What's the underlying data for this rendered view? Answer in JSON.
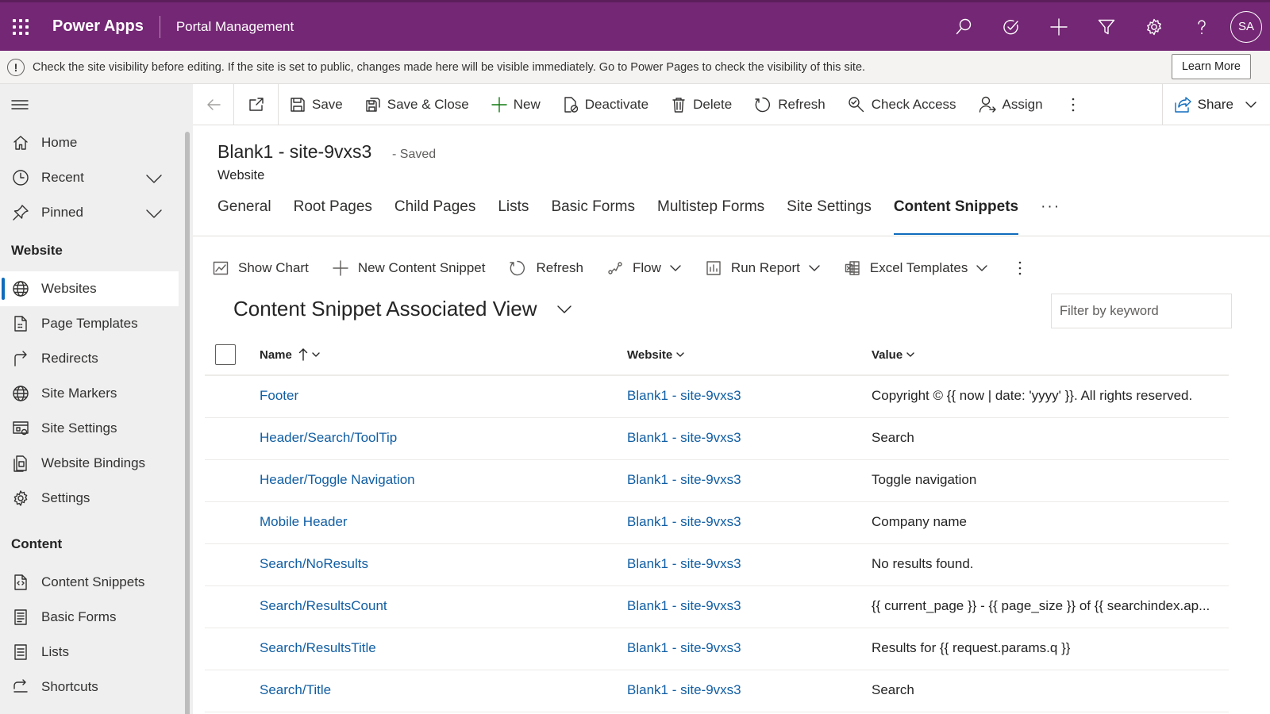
{
  "header": {
    "app_name": "Power Apps",
    "env_name": "Portal Management",
    "user_initials": "SA",
    "icons": [
      "search-icon",
      "task-icon",
      "plus-icon",
      "filter-icon",
      "settings-icon",
      "help-icon"
    ]
  },
  "notice": {
    "text": "Check the site visibility before editing. If the site is set to public, changes made here will be visible immediately. Go to Power Pages to check the visibility of this site.",
    "button": "Learn More"
  },
  "sidebar": {
    "top_items": [
      {
        "label": "Home",
        "icon": "home-icon"
      },
      {
        "label": "Recent",
        "icon": "clock-icon"
      },
      {
        "label": "Pinned",
        "icon": "pin-icon"
      }
    ],
    "groups": [
      {
        "title": "Website",
        "items": [
          {
            "label": "Websites",
            "icon": "globe-icon",
            "active": true
          },
          {
            "label": "Page Templates",
            "icon": "page-icon"
          },
          {
            "label": "Redirects",
            "icon": "redirect-icon"
          },
          {
            "label": "Site Markers",
            "icon": "globe-icon"
          },
          {
            "label": "Site Settings",
            "icon": "settings-grid-icon"
          },
          {
            "label": "Website Bindings",
            "icon": "binding-icon"
          },
          {
            "label": "Settings",
            "icon": "gear-icon"
          }
        ]
      },
      {
        "title": "Content",
        "items": [
          {
            "label": "Content Snippets",
            "icon": "snippet-icon"
          },
          {
            "label": "Basic Forms",
            "icon": "form-icon"
          },
          {
            "label": "Lists",
            "icon": "list-icon"
          },
          {
            "label": "Shortcuts",
            "icon": "shortcut-icon"
          }
        ]
      }
    ]
  },
  "commands": {
    "save": "Save",
    "save_close": "Save & Close",
    "new": "New",
    "deactivate": "Deactivate",
    "delete": "Delete",
    "refresh": "Refresh",
    "check_access": "Check Access",
    "assign": "Assign",
    "share": "Share"
  },
  "form": {
    "title": "Blank1 - site-9vxs3",
    "status": "- Saved",
    "entity": "Website",
    "tabs": [
      "General",
      "Root Pages",
      "Child Pages",
      "Lists",
      "Basic Forms",
      "Multistep Forms",
      "Site Settings",
      "Content Snippets"
    ],
    "active_tab": "Content Snippets",
    "more": "···"
  },
  "subgrid": {
    "commands": {
      "show_chart": "Show Chart",
      "new_snippet": "New Content Snippet",
      "refresh": "Refresh",
      "flow": "Flow",
      "run_report": "Run Report",
      "excel": "Excel Templates"
    },
    "view_title": "Content Snippet Associated View",
    "filter_placeholder": "Filter by keyword",
    "columns": {
      "name": "Name",
      "website": "Website",
      "value": "Value"
    },
    "rows": [
      {
        "name": "Footer",
        "website": "Blank1 - site-9vxs3",
        "value": "Copyright © {{ now | date: 'yyyy' }}. All rights reserved."
      },
      {
        "name": "Header/Search/ToolTip",
        "website": "Blank1 - site-9vxs3",
        "value": "Search"
      },
      {
        "name": "Header/Toggle Navigation",
        "website": "Blank1 - site-9vxs3",
        "value": "Toggle navigation"
      },
      {
        "name": "Mobile Header",
        "website": "Blank1 - site-9vxs3",
        "value": "Company name"
      },
      {
        "name": "Search/NoResults",
        "website": "Blank1 - site-9vxs3",
        "value": "No results found."
      },
      {
        "name": "Search/ResultsCount",
        "website": "Blank1 - site-9vxs3",
        "value": "{{ current_page }} - {{ page_size }} of {{ searchindex.ap..."
      },
      {
        "name": "Search/ResultsTitle",
        "website": "Blank1 - site-9vxs3",
        "value": "Results for {{ request.params.q }}"
      },
      {
        "name": "Search/Title",
        "website": "Blank1 - site-9vxs3",
        "value": "Search"
      }
    ]
  },
  "colors": {
    "brand": "#742774",
    "link": "#115ea3",
    "accent": "#0f6cbd"
  }
}
